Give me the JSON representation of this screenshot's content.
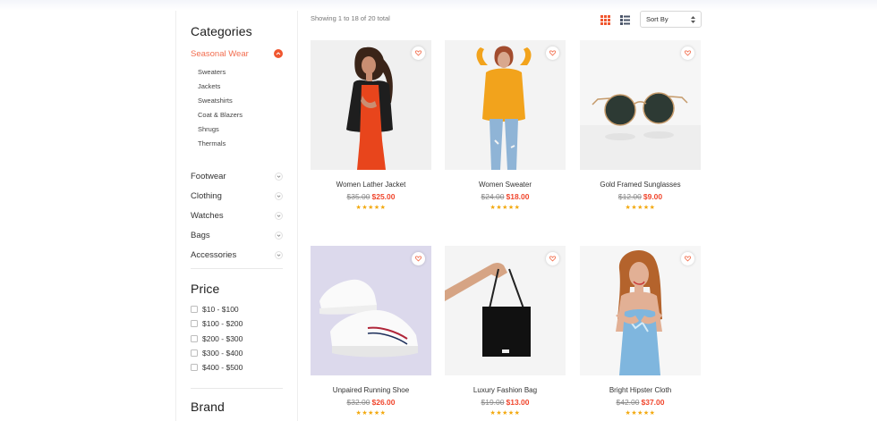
{
  "sidebar": {
    "categories_title": "Categories",
    "active_category": "Seasonal Wear",
    "subcategories": [
      "Sweaters",
      "Jackets",
      "Sweatshirts",
      "Coat & Blazers",
      "Shrugs",
      "Thermals"
    ],
    "categories": [
      "Footwear",
      "Clothing",
      "Watches",
      "Bags",
      "Accessories"
    ],
    "price_title": "Price",
    "price_ranges": [
      "$10 - $100",
      "$100 - $200",
      "$200 - $300",
      "$300 - $400",
      "$400 - $500"
    ],
    "brand_title": "Brand"
  },
  "toolbar": {
    "results_text": "Showing 1 to 18 of 20 total",
    "sort_label": "Sort By",
    "grid_icon": "grid-view-icon",
    "list_icon": "list-view-icon"
  },
  "products": [
    {
      "name": "Women Lather Jacket",
      "old_price": "$35.00",
      "new_price": "$25.00",
      "rating": 5
    },
    {
      "name": "Women Sweater",
      "old_price": "$24.00",
      "new_price": "$18.00",
      "rating": 5
    },
    {
      "name": "Gold Framed Sunglasses",
      "old_price": "$12.00",
      "new_price": "$9.00",
      "rating": 5
    },
    {
      "name": "Unpaired Running Shoe",
      "old_price": "$32.00",
      "new_price": "$26.00",
      "rating": 5
    },
    {
      "name": "Luxury Fashion Bag",
      "old_price": "$19.00",
      "new_price": "$13.00",
      "rating": 5
    },
    {
      "name": "Bright Hipster Cloth",
      "old_price": "$42.00",
      "new_price": "$37.00",
      "rating": 5
    }
  ],
  "colors": {
    "accent": "#f0562f",
    "price": "#f0462d",
    "star": "#f3a90f"
  },
  "stars_text": "★★★★★"
}
